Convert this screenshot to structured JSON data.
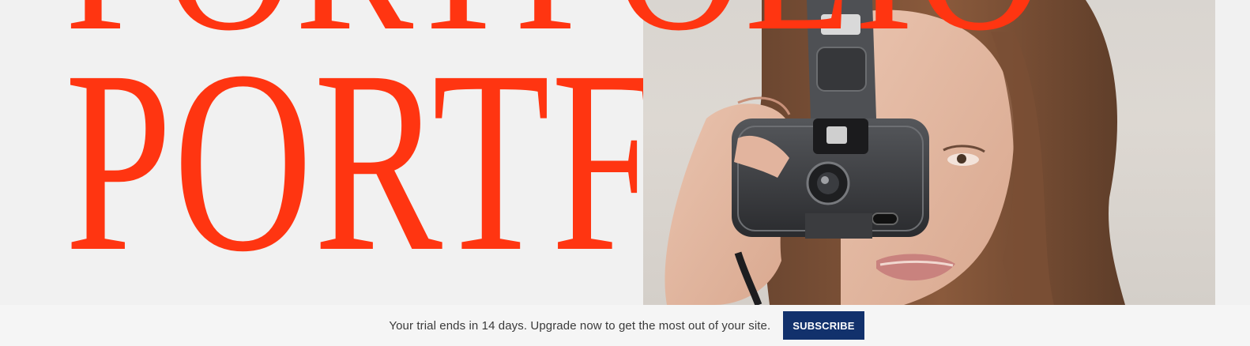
{
  "hero": {
    "title_top": "PORTFOLIO",
    "title_bottom": "PORTFOLIO",
    "title_color": "#ff3511",
    "photo_subject": "woman holding a film camera over her face"
  },
  "trial_bar": {
    "message": "Your trial ends in 14 days. Upgrade now to get the most out of your site.",
    "subscribe_label": "SUBSCRIBE",
    "button_color": "#12316c"
  }
}
